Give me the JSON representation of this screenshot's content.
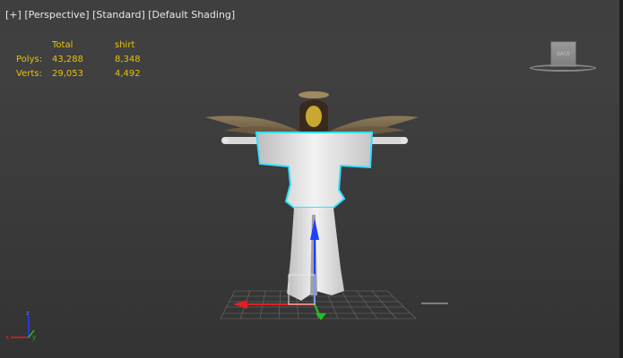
{
  "viewport_menu": {
    "plus": "[+]",
    "view": "[Perspective]",
    "render_mode": "[Standard]",
    "shading": "[Default Shading]"
  },
  "stats": {
    "header_total": "Total",
    "header_selected": "shirt",
    "polys_label": "Polys:",
    "polys_total": "43,288",
    "polys_selected": "8,348",
    "verts_label": "Verts:",
    "verts_total": "29,053",
    "verts_selected": "4,492"
  },
  "viewcube": {
    "face_label": "BACK"
  },
  "axes": {
    "x": "x",
    "y": "y",
    "z": "z"
  },
  "gizmo": {
    "z_label": "z"
  },
  "colors": {
    "stats_text": "#e6c300",
    "selection_outline": "#33e0ff",
    "gizmo_x": "#e02020",
    "gizmo_y": "#20c020",
    "gizmo_z": "#2040ff"
  }
}
